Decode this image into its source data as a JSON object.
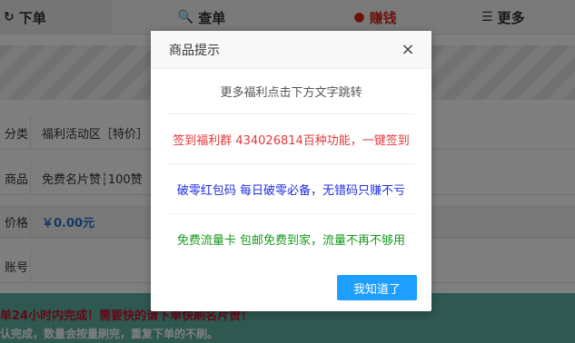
{
  "tabs": [
    {
      "icon": "↻",
      "label": "下单"
    },
    {
      "icon": "🔍",
      "label": "查单"
    },
    {
      "icon": "●",
      "label": "赚钱"
    },
    {
      "icon": "☰",
      "label": "更多"
    }
  ],
  "form": [
    {
      "label": "分类",
      "value": "福利活动区［特价］"
    },
    {
      "label": "商品",
      "value": "免费名片赞┆100赞"
    },
    {
      "label": "价格",
      "value": "￥0.00元"
    },
    {
      "label": "账号",
      "value": ""
    }
  ],
  "notice": {
    "line1": "单24小时内完成！需要快的请下单快刷名片赞！",
    "line2": "认完成，数量会按量刷完，重复下单的不刷。"
  },
  "modal": {
    "title": "商品提示",
    "close_label": "×",
    "lines": [
      "更多福利点击下方文字跳转",
      "签到福利群 434026814百种功能，一键签到",
      "破零红包码 每日破零必备，无错码只赚不亏",
      "免费流量卡 包邮免费到家，流量不再不够用"
    ],
    "ok_label": "我知道了"
  },
  "colors": {
    "accent_button": "#1e9fff",
    "line_red": "#e4393c",
    "line_blue": "#1f2fe0",
    "line_green": "#159a1c",
    "tab_active": "#d9261c",
    "notice_bg": "#5fb0a2"
  }
}
